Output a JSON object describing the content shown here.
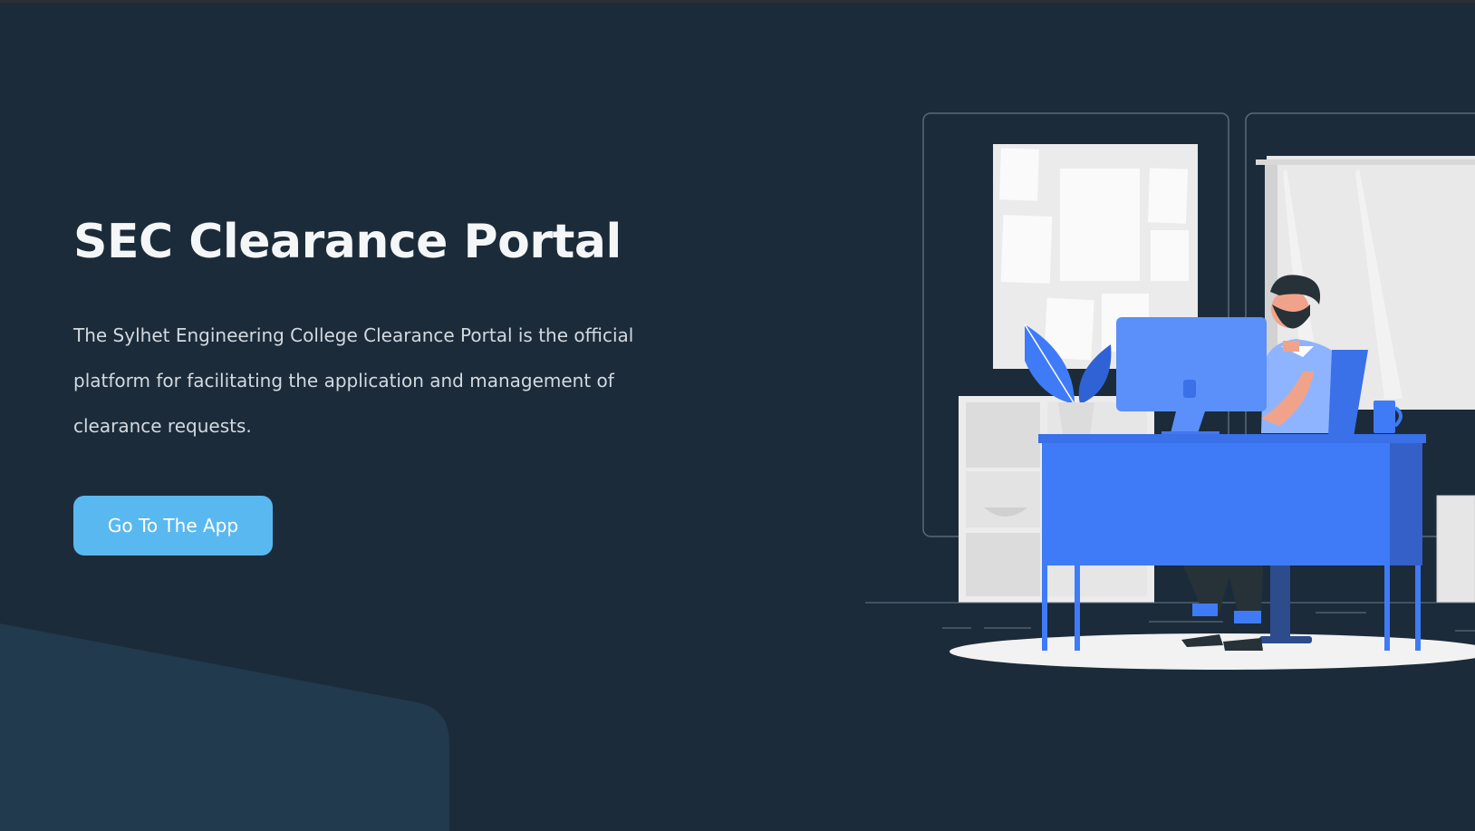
{
  "hero": {
    "title": "SEC Clearance Portal",
    "description": "The Sylhet Engineering College Clearance Portal is the official platform for facilitating the application and management of clearance requests.",
    "cta_label": "Go To The App"
  },
  "colors": {
    "background": "#1b2b3a",
    "accent_button": "#5ab8f0",
    "illustration_blue": "#3f7bf7",
    "bottom_shape": "#213a4d"
  },
  "illustration": {
    "name": "person-at-desk-illustration"
  }
}
